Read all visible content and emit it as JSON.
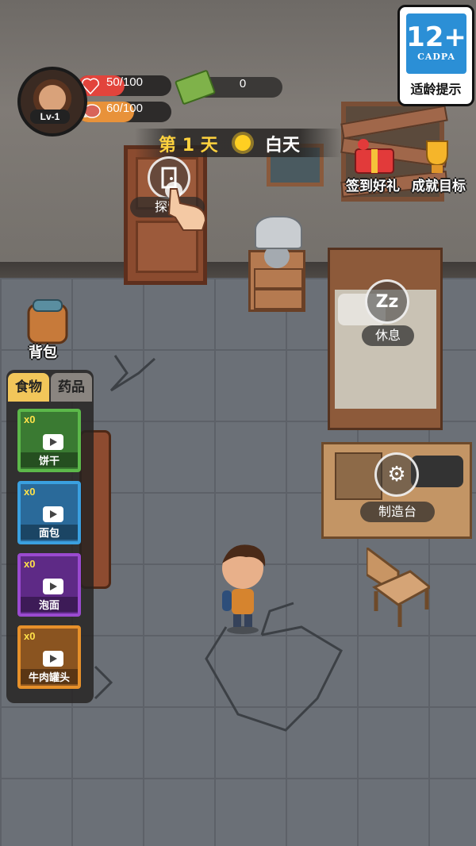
{
  "age_rating": {
    "number": "12+",
    "org": "CADPA",
    "label": "适龄提示"
  },
  "player": {
    "level": "Lv-1",
    "health": "50/100",
    "health_ratio": 0.5,
    "hunger": "60/100",
    "hunger_ratio": 0.6,
    "money": "0"
  },
  "day_banner": {
    "prefix": "第",
    "day": "1",
    "unit": "天",
    "time": "白天"
  },
  "actions": {
    "explore": "探索",
    "signin": "签到好礼",
    "achievements": "成就目标",
    "rest": "休息",
    "craft": "制造台",
    "backpack": "背包"
  },
  "inventory": {
    "tabs": [
      "食物",
      "药品"
    ],
    "active_tab": "食物",
    "items": [
      {
        "name": "饼干",
        "count": "x0",
        "color": "#5cb84a"
      },
      {
        "name": "面包",
        "count": "x0",
        "color": "#3aa0e0"
      },
      {
        "name": "泡面",
        "count": "x0",
        "color": "#9a4ad0"
      },
      {
        "name": "牛肉罐头",
        "count": "x0",
        "color": "#e6902a"
      }
    ]
  },
  "colors": {
    "hp": "#e2443c",
    "hunger": "#e8923a",
    "gold": "#ffd23e"
  }
}
